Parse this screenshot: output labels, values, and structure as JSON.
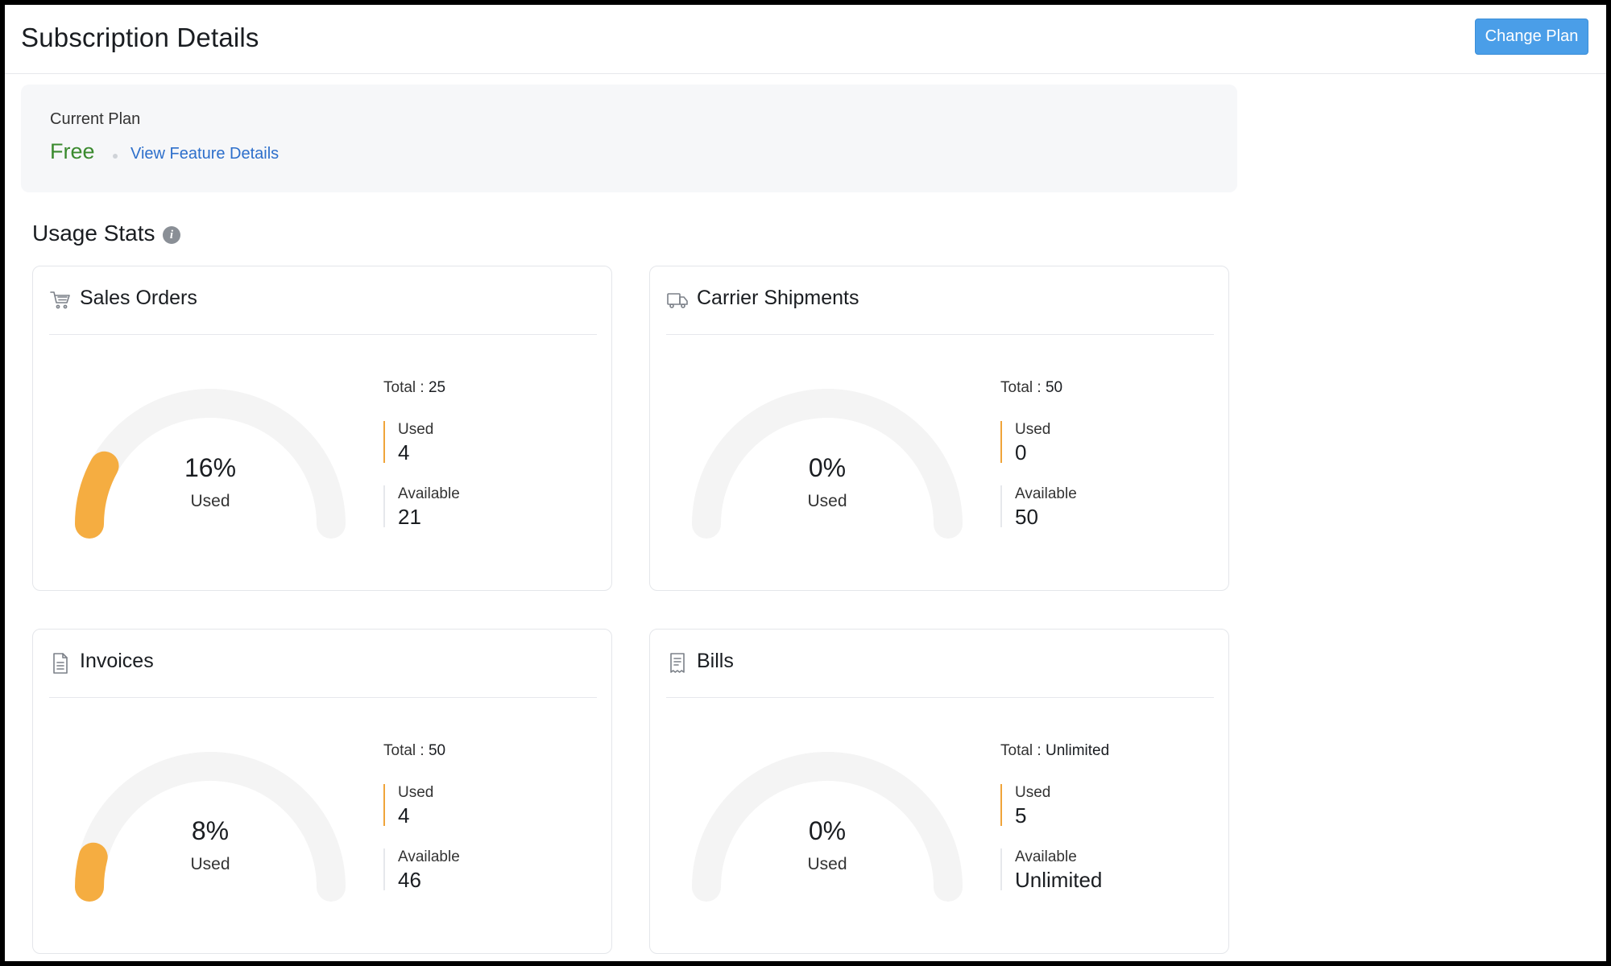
{
  "header": {
    "title": "Subscription Details",
    "change_plan_label": "Change Plan"
  },
  "plan": {
    "label": "Current Plan",
    "name": "Free",
    "feature_link": "View Feature Details"
  },
  "usage": {
    "title": "Usage Stats",
    "info_glyph": "i",
    "gauge_track_color": "#f4f4f4",
    "gauge_fill_color": "#f5ad41",
    "cards": [
      {
        "title": "Sales Orders",
        "icon": "cart-icon",
        "percent_label": "16%",
        "used_fraction": 0.16,
        "used_caption": "Used",
        "total_label": "Total :",
        "total_value": "25",
        "used_label": "Used",
        "used_value": "4",
        "available_label": "Available",
        "available_value": "21"
      },
      {
        "title": "Carrier Shipments",
        "icon": "truck-icon",
        "percent_label": "0%",
        "used_fraction": 0,
        "used_caption": "Used",
        "total_label": "Total :",
        "total_value": "50",
        "used_label": "Used",
        "used_value": "0",
        "available_label": "Available",
        "available_value": "50"
      },
      {
        "title": "Invoices",
        "icon": "document-icon",
        "percent_label": "8%",
        "used_fraction": 0.08,
        "used_caption": "Used",
        "total_label": "Total :",
        "total_value": "50",
        "used_label": "Used",
        "used_value": "4",
        "available_label": "Available",
        "available_value": "46"
      },
      {
        "title": "Bills",
        "icon": "receipt-icon",
        "percent_label": "0%",
        "used_fraction": 0,
        "used_caption": "Used",
        "total_label": "Total :",
        "total_value": "Unlimited",
        "used_label": "Used",
        "used_value": "5",
        "available_label": "Available",
        "available_value": "Unlimited"
      }
    ]
  }
}
